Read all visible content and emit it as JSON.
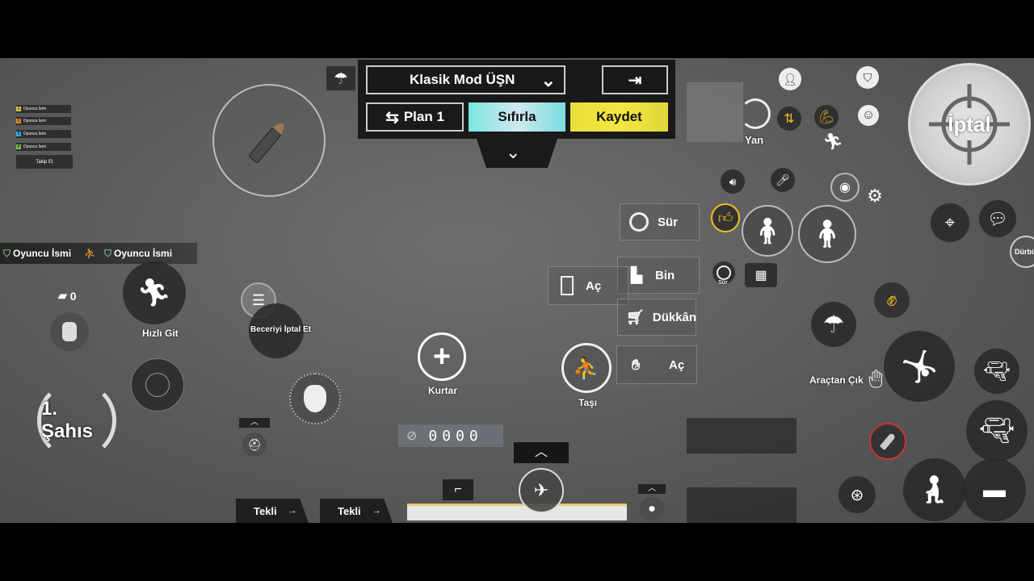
{
  "team": {
    "players": [
      {
        "num": "1",
        "name": "Oyuncu İsmi",
        "color": "#d6c23a"
      },
      {
        "num": "2",
        "name": "Oyuncu İsmi",
        "color": "#e0892d"
      },
      {
        "num": "3",
        "name": "Oyuncu İsmi",
        "color": "#3fa9e0"
      },
      {
        "num": "4",
        "name": "Oyuncu İsmi",
        "color": "#6fbf40"
      }
    ],
    "follow_label": "Takip Et"
  },
  "killfeed": {
    "killer": "Oyuncu İsmi",
    "victim": "Oyuncu İsmi"
  },
  "top_panel": {
    "mode_select": "Klasik Mod ÜŞN",
    "plan_label": "Plan 1",
    "reset_label": "Sıfırla",
    "save_label": "Kaydet"
  },
  "left": {
    "bandage_count": "0",
    "sprint_label": "Hızlı Git",
    "perspective_label": "1. Şahıs",
    "cancel_skill_label": "Beceriyi İptal Et"
  },
  "center": {
    "revive_label": "Kurtar",
    "carry_label": "Taşı",
    "ammo_counter": "0000"
  },
  "interactions": {
    "drive": "Sür",
    "board": "Bin",
    "open_door": "Aç",
    "shop": "Dükkân",
    "open_other": "Aç"
  },
  "right": {
    "side_label": "Yan",
    "cancel_label": "İptal",
    "exit_vehicle_label": "Araçtan Çık",
    "drive_small_label": "Sür",
    "right_edge_label": "Dürbü"
  },
  "bottom": {
    "fire_mode_1": "Tekli",
    "fire_mode_2": "Tekli"
  },
  "icons": [
    "parachute-icon",
    "bullet-icon",
    "door-exit-icon",
    "swap-icon",
    "chevron-down-icon",
    "sprint-icon",
    "backpack-icon",
    "bandage-icon",
    "plus-icon",
    "carry-icon",
    "steering-wheel-icon",
    "seat-icon",
    "door-icon",
    "shop-cart-icon",
    "hand-icon",
    "gear-icon",
    "eye-icon",
    "microphone-icon",
    "speaker-icon",
    "thumbs-up-icon",
    "location-pin-icon",
    "chat-icon",
    "crosshair-icon",
    "shield-icon",
    "smiley-icon",
    "pistol-icon",
    "grenade-icon",
    "crouch-icon",
    "prone-icon",
    "lean-left-icon",
    "lean-right-icon",
    "jump-icon",
    "reload-icon"
  ]
}
